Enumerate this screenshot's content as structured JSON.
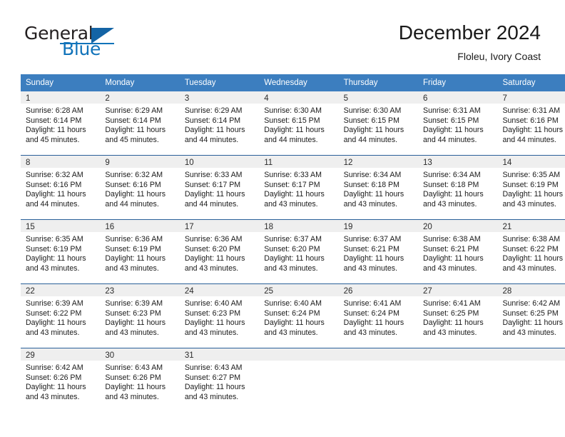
{
  "logo": {
    "text_top": "General",
    "text_bottom": "Blue",
    "icon": "triangle-icon",
    "brand_color": "#1173ba",
    "dark_color": "#231f20"
  },
  "header": {
    "title": "December 2024",
    "location": "Floleu, Ivory Coast"
  },
  "calendar": {
    "header_color": "#3c7ebf",
    "row_border_color": "#2a6099",
    "daynum_band_color": "#efefef",
    "weekday_headers": [
      "Sunday",
      "Monday",
      "Tuesday",
      "Wednesday",
      "Thursday",
      "Friday",
      "Saturday"
    ],
    "weeks": [
      [
        {
          "day": "1",
          "sunrise": "Sunrise: 6:28 AM",
          "sunset": "Sunset: 6:14 PM",
          "daylight1": "Daylight: 11 hours",
          "daylight2": "and 45 minutes."
        },
        {
          "day": "2",
          "sunrise": "Sunrise: 6:29 AM",
          "sunset": "Sunset: 6:14 PM",
          "daylight1": "Daylight: 11 hours",
          "daylight2": "and 45 minutes."
        },
        {
          "day": "3",
          "sunrise": "Sunrise: 6:29 AM",
          "sunset": "Sunset: 6:14 PM",
          "daylight1": "Daylight: 11 hours",
          "daylight2": "and 44 minutes."
        },
        {
          "day": "4",
          "sunrise": "Sunrise: 6:30 AM",
          "sunset": "Sunset: 6:15 PM",
          "daylight1": "Daylight: 11 hours",
          "daylight2": "and 44 minutes."
        },
        {
          "day": "5",
          "sunrise": "Sunrise: 6:30 AM",
          "sunset": "Sunset: 6:15 PM",
          "daylight1": "Daylight: 11 hours",
          "daylight2": "and 44 minutes."
        },
        {
          "day": "6",
          "sunrise": "Sunrise: 6:31 AM",
          "sunset": "Sunset: 6:15 PM",
          "daylight1": "Daylight: 11 hours",
          "daylight2": "and 44 minutes."
        },
        {
          "day": "7",
          "sunrise": "Sunrise: 6:31 AM",
          "sunset": "Sunset: 6:16 PM",
          "daylight1": "Daylight: 11 hours",
          "daylight2": "and 44 minutes."
        }
      ],
      [
        {
          "day": "8",
          "sunrise": "Sunrise: 6:32 AM",
          "sunset": "Sunset: 6:16 PM",
          "daylight1": "Daylight: 11 hours",
          "daylight2": "and 44 minutes."
        },
        {
          "day": "9",
          "sunrise": "Sunrise: 6:32 AM",
          "sunset": "Sunset: 6:16 PM",
          "daylight1": "Daylight: 11 hours",
          "daylight2": "and 44 minutes."
        },
        {
          "day": "10",
          "sunrise": "Sunrise: 6:33 AM",
          "sunset": "Sunset: 6:17 PM",
          "daylight1": "Daylight: 11 hours",
          "daylight2": "and 44 minutes."
        },
        {
          "day": "11",
          "sunrise": "Sunrise: 6:33 AM",
          "sunset": "Sunset: 6:17 PM",
          "daylight1": "Daylight: 11 hours",
          "daylight2": "and 43 minutes."
        },
        {
          "day": "12",
          "sunrise": "Sunrise: 6:34 AM",
          "sunset": "Sunset: 6:18 PM",
          "daylight1": "Daylight: 11 hours",
          "daylight2": "and 43 minutes."
        },
        {
          "day": "13",
          "sunrise": "Sunrise: 6:34 AM",
          "sunset": "Sunset: 6:18 PM",
          "daylight1": "Daylight: 11 hours",
          "daylight2": "and 43 minutes."
        },
        {
          "day": "14",
          "sunrise": "Sunrise: 6:35 AM",
          "sunset": "Sunset: 6:19 PM",
          "daylight1": "Daylight: 11 hours",
          "daylight2": "and 43 minutes."
        }
      ],
      [
        {
          "day": "15",
          "sunrise": "Sunrise: 6:35 AM",
          "sunset": "Sunset: 6:19 PM",
          "daylight1": "Daylight: 11 hours",
          "daylight2": "and 43 minutes."
        },
        {
          "day": "16",
          "sunrise": "Sunrise: 6:36 AM",
          "sunset": "Sunset: 6:19 PM",
          "daylight1": "Daylight: 11 hours",
          "daylight2": "and 43 minutes."
        },
        {
          "day": "17",
          "sunrise": "Sunrise: 6:36 AM",
          "sunset": "Sunset: 6:20 PM",
          "daylight1": "Daylight: 11 hours",
          "daylight2": "and 43 minutes."
        },
        {
          "day": "18",
          "sunrise": "Sunrise: 6:37 AM",
          "sunset": "Sunset: 6:20 PM",
          "daylight1": "Daylight: 11 hours",
          "daylight2": "and 43 minutes."
        },
        {
          "day": "19",
          "sunrise": "Sunrise: 6:37 AM",
          "sunset": "Sunset: 6:21 PM",
          "daylight1": "Daylight: 11 hours",
          "daylight2": "and 43 minutes."
        },
        {
          "day": "20",
          "sunrise": "Sunrise: 6:38 AM",
          "sunset": "Sunset: 6:21 PM",
          "daylight1": "Daylight: 11 hours",
          "daylight2": "and 43 minutes."
        },
        {
          "day": "21",
          "sunrise": "Sunrise: 6:38 AM",
          "sunset": "Sunset: 6:22 PM",
          "daylight1": "Daylight: 11 hours",
          "daylight2": "and 43 minutes."
        }
      ],
      [
        {
          "day": "22",
          "sunrise": "Sunrise: 6:39 AM",
          "sunset": "Sunset: 6:22 PM",
          "daylight1": "Daylight: 11 hours",
          "daylight2": "and 43 minutes."
        },
        {
          "day": "23",
          "sunrise": "Sunrise: 6:39 AM",
          "sunset": "Sunset: 6:23 PM",
          "daylight1": "Daylight: 11 hours",
          "daylight2": "and 43 minutes."
        },
        {
          "day": "24",
          "sunrise": "Sunrise: 6:40 AM",
          "sunset": "Sunset: 6:23 PM",
          "daylight1": "Daylight: 11 hours",
          "daylight2": "and 43 minutes."
        },
        {
          "day": "25",
          "sunrise": "Sunrise: 6:40 AM",
          "sunset": "Sunset: 6:24 PM",
          "daylight1": "Daylight: 11 hours",
          "daylight2": "and 43 minutes."
        },
        {
          "day": "26",
          "sunrise": "Sunrise: 6:41 AM",
          "sunset": "Sunset: 6:24 PM",
          "daylight1": "Daylight: 11 hours",
          "daylight2": "and 43 minutes."
        },
        {
          "day": "27",
          "sunrise": "Sunrise: 6:41 AM",
          "sunset": "Sunset: 6:25 PM",
          "daylight1": "Daylight: 11 hours",
          "daylight2": "and 43 minutes."
        },
        {
          "day": "28",
          "sunrise": "Sunrise: 6:42 AM",
          "sunset": "Sunset: 6:25 PM",
          "daylight1": "Daylight: 11 hours",
          "daylight2": "and 43 minutes."
        }
      ],
      [
        {
          "day": "29",
          "sunrise": "Sunrise: 6:42 AM",
          "sunset": "Sunset: 6:26 PM",
          "daylight1": "Daylight: 11 hours",
          "daylight2": "and 43 minutes."
        },
        {
          "day": "30",
          "sunrise": "Sunrise: 6:43 AM",
          "sunset": "Sunset: 6:26 PM",
          "daylight1": "Daylight: 11 hours",
          "daylight2": "and 43 minutes."
        },
        {
          "day": "31",
          "sunrise": "Sunrise: 6:43 AM",
          "sunset": "Sunset: 6:27 PM",
          "daylight1": "Daylight: 11 hours",
          "daylight2": "and 43 minutes."
        },
        {
          "day": "",
          "sunrise": "",
          "sunset": "",
          "daylight1": "",
          "daylight2": "",
          "empty": true
        },
        {
          "day": "",
          "sunrise": "",
          "sunset": "",
          "daylight1": "",
          "daylight2": "",
          "empty": true
        },
        {
          "day": "",
          "sunrise": "",
          "sunset": "",
          "daylight1": "",
          "daylight2": "",
          "empty": true
        },
        {
          "day": "",
          "sunrise": "",
          "sunset": "",
          "daylight1": "",
          "daylight2": "",
          "empty": true
        }
      ]
    ]
  }
}
